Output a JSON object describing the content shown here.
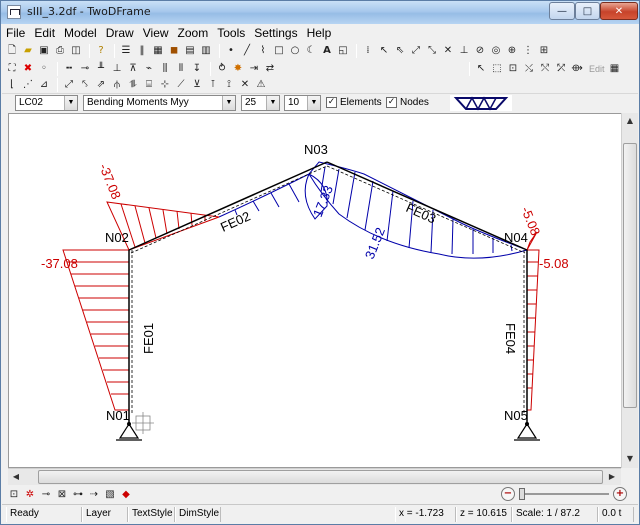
{
  "window": {
    "title": "sIII_3.2df - TwoDFrame",
    "minimize_glyph": "—",
    "maximize_glyph": "□",
    "close_glyph": "✕"
  },
  "menu": [
    "File",
    "Edit",
    "Model",
    "Draw",
    "View",
    "Zoom",
    "Tools",
    "Settings",
    "Help"
  ],
  "toolbar": {
    "edit_label": "Edit"
  },
  "options": {
    "load_case": "LC02",
    "result_type": "Bending Moments Myy",
    "scale_value": "25",
    "font_size": "10",
    "show_elements_label": "Elements",
    "show_elements_checked": "✓",
    "show_nodes_label": "Nodes",
    "show_nodes_checked": "✓"
  },
  "model": {
    "nodes": [
      {
        "name": "N01"
      },
      {
        "name": "N02"
      },
      {
        "name": "N03"
      },
      {
        "name": "N04"
      },
      {
        "name": "N05"
      }
    ],
    "elements": [
      {
        "name": "FE01"
      },
      {
        "name": "FE02"
      },
      {
        "name": "FE03"
      },
      {
        "name": "FE04"
      }
    ],
    "moment_labels": [
      {
        "text": "-37.08",
        "location": "column FE01 top"
      },
      {
        "text": "-37.08",
        "location": "rafter FE02 start"
      },
      {
        "text": "17.33",
        "location": "ridge N03"
      },
      {
        "text": "31.52",
        "location": "rafter FE03 midspan"
      },
      {
        "text": "-5.08",
        "location": "rafter FE03 end"
      },
      {
        "text": "-5.08",
        "location": "column FE04 top"
      }
    ],
    "colors": {
      "negative_moment": "#cc0000",
      "positive_moment": "#0000aa",
      "frame": "#000000"
    }
  },
  "status": {
    "state": "Ready",
    "layer": "Layer",
    "text_style": "TextStyle",
    "dim_style": "DimStyle",
    "x_coord": "x = -1.723",
    "z_coord": "z = 10.615",
    "scale": "Scale: 1 / 87.2",
    "extra": "0.0 t"
  }
}
